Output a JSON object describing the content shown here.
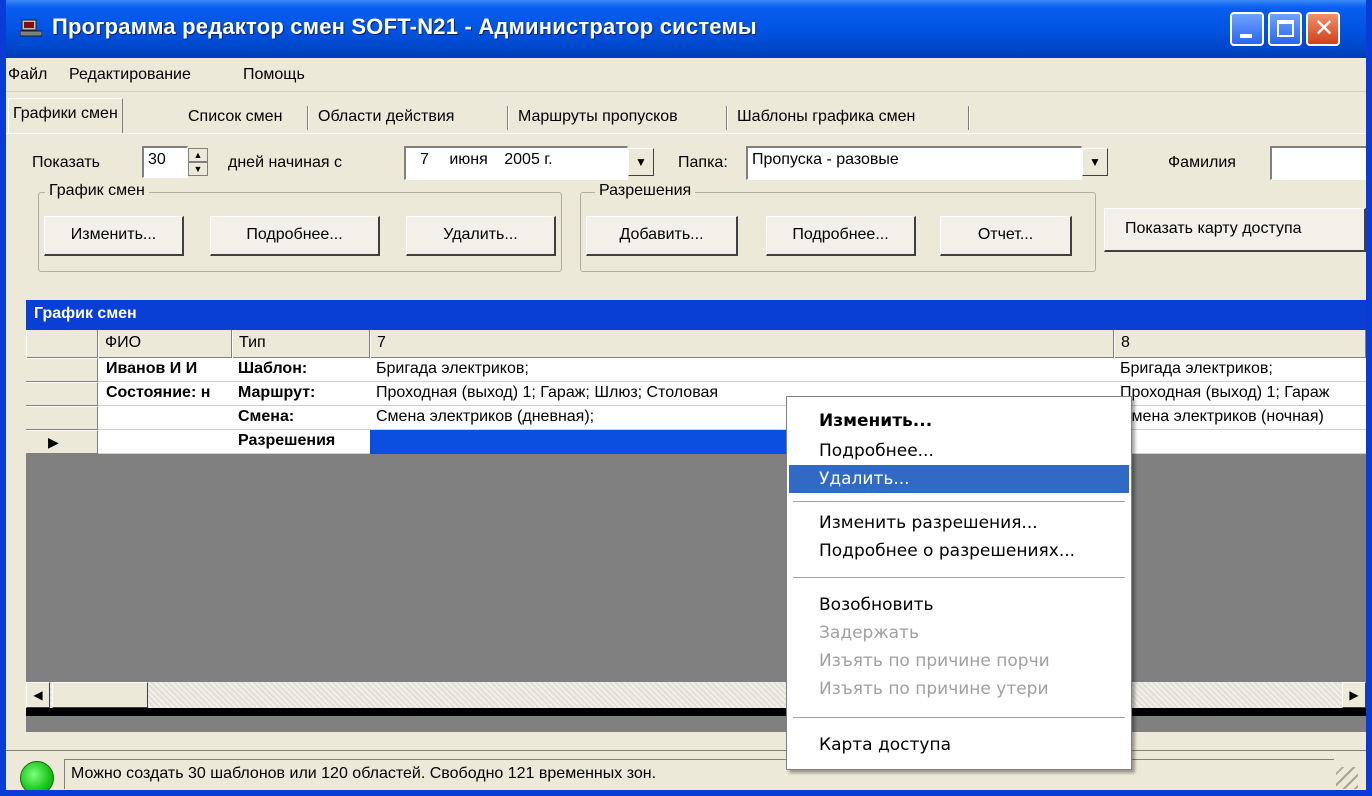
{
  "window": {
    "title": "Программа редактор смен SOFT-N21 - Администратор системы"
  },
  "menu": [
    "Файл",
    "Редактирование",
    "Помощь"
  ],
  "tabs": [
    "Графики смен",
    "Список смен",
    "Области действия",
    "Маршруты пропусков",
    "Шаблоны графика смен"
  ],
  "filters": {
    "show_label": "Показать",
    "days_value": "30",
    "days_label": "дней начиная с",
    "date_day": "7",
    "date_month": "июня",
    "date_year": "2005 г.",
    "folder_label": "Папка:",
    "folder_value": "Пропуска - разовые",
    "surname_label": "Фамилия"
  },
  "schedule_group": {
    "title": "График смен",
    "edit": "Изменить...",
    "details": "Подробнее...",
    "delete": "Удалить..."
  },
  "permissions_group": {
    "title": "Разрешения",
    "add": "Добавить...",
    "details": "Подробнее...",
    "report": "Отчет..."
  },
  "show_map_button": "Показать карту доступа",
  "grid": {
    "caption": "График смен",
    "columns": [
      "ФИО",
      "Тип",
      "7",
      "8"
    ],
    "rows": [
      {
        "fio": "Иванов И И",
        "type": "Шаблон:",
        "d7": "Бригада электриков;",
        "d8": "Бригада электриков;"
      },
      {
        "fio": "Состояние: н",
        "type": "Маршрут:",
        "d7": "Проходная (выход) 1; Гараж; Шлюз; Столовая",
        "d8": "Проходная (выход) 1; Гараж"
      },
      {
        "fio": "",
        "type": "Смена:",
        "d7": "Смена электриков (дневная);",
        "d8": "Смена электриков (ночная)"
      },
      {
        "fio": "",
        "type": "Разрешения",
        "d7": "",
        "d8": ""
      }
    ]
  },
  "context_menu": {
    "items": [
      {
        "label": "Изменить...",
        "state": "bold"
      },
      {
        "label": "Подробнее...",
        "state": "normal"
      },
      {
        "label": "Удалить...",
        "state": "highlighted"
      },
      {
        "label": "Изменить разрешения...",
        "state": "normal"
      },
      {
        "label": "Подробнее о разрешениях...",
        "state": "normal"
      },
      {
        "label": "Возобновить",
        "state": "normal"
      },
      {
        "label": "Задержать",
        "state": "disabled"
      },
      {
        "label": "Изъять по причине порчи",
        "state": "disabled"
      },
      {
        "label": "Изъять по причине утери",
        "state": "disabled"
      },
      {
        "label": "Карта доступа",
        "state": "normal"
      }
    ]
  },
  "status": {
    "text": "Можно создать 30 шаблонов или 120 областей. Свободно 121 временных зон.",
    "indicator_color": "#17c317"
  },
  "colors": {
    "titlebar": "#0054e3",
    "selection": "#316ac5",
    "grid_caption": "#0a3fd6"
  }
}
